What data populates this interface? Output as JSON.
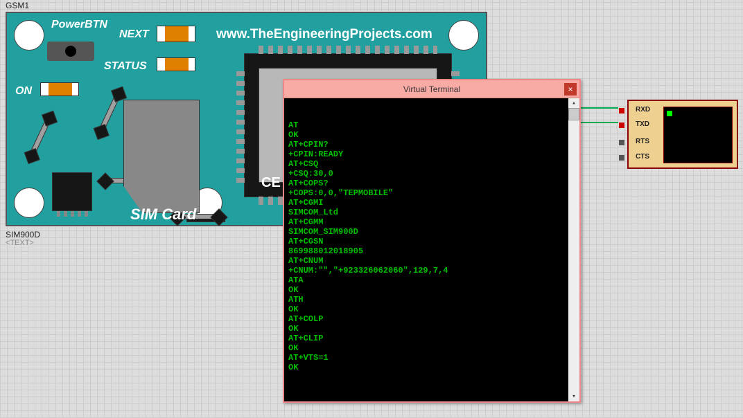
{
  "designator": "GSM1",
  "part": "SIM900D",
  "text_field": "<TEXT>",
  "board": {
    "power_btn": "PowerBTN",
    "next": "NEXT",
    "status": "STATUS",
    "on": "ON",
    "sim": "SIM Card",
    "url": "www.TheEngineeringProjects.com",
    "ce": "CE"
  },
  "terminal": {
    "title": "Virtual Terminal",
    "close": "×",
    "lines": [
      "AT",
      "OK",
      "AT+CPIN?",
      "+CPIN:READY",
      "AT+CSQ",
      "+CSQ:30,0",
      "AT+COPS?",
      "+COPS:0,0,\"TEPMOBILE\"",
      "AT+CGMI",
      "SIMCOM_Ltd",
      "AT+CGMM",
      "SIMCOM_SIM900D",
      "AT+CGSN",
      "869988012018905",
      "AT+CNUM",
      "+CNUM:\"\",\"+923326062060\",129,7,4",
      "ATA",
      "OK",
      "ATH",
      "OK",
      "AT+COLP",
      "OK",
      "AT+CLIP",
      "OK",
      "AT+VTS=1",
      "OK"
    ]
  },
  "vt": {
    "rxd": "RXD",
    "txd": "TXD",
    "rts": "RTS",
    "cts": "CTS"
  }
}
